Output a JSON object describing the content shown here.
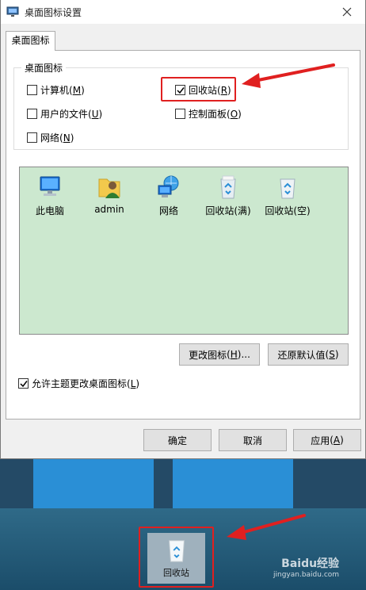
{
  "window": {
    "title": "桌面图标设置"
  },
  "tabs": [
    {
      "label": "桌面图标"
    }
  ],
  "group": {
    "label": "桌面图标",
    "checkboxes": [
      {
        "label": "计算机",
        "key": "M",
        "checked": false
      },
      {
        "label": "回收站",
        "key": "R",
        "checked": true
      },
      {
        "label": "用户的文件",
        "key": "U",
        "checked": false
      },
      {
        "label": "控制面板",
        "key": "O",
        "checked": false
      },
      {
        "label": "网络",
        "key": "N",
        "checked": false
      }
    ]
  },
  "icon_view": {
    "background": "#cce8cf",
    "items": [
      {
        "label": "此电脑",
        "icon": "computer-icon"
      },
      {
        "label": "admin",
        "icon": "user-folder-icon"
      },
      {
        "label": "网络",
        "icon": "network-icon"
      },
      {
        "label": "回收站(满)",
        "icon": "recycle-bin-full-icon"
      },
      {
        "label": "回收站(空)",
        "icon": "recycle-bin-empty-icon"
      }
    ]
  },
  "buttons": {
    "change_icon": {
      "label": "更改图标",
      "key": "H",
      "suffix": "..."
    },
    "restore_default": {
      "label": "还原默认值",
      "key": "S"
    },
    "ok": {
      "label": "确定"
    },
    "cancel": {
      "label": "取消"
    },
    "apply": {
      "label": "应用",
      "key": "A"
    }
  },
  "allow_themes": {
    "label": "允许主题更改桌面图标",
    "key": "L",
    "checked": true
  },
  "desktop": {
    "recycle_bin_label": "回收站"
  },
  "watermark": {
    "main": "Baidu经验",
    "sub": "jingyan.baidu.com"
  },
  "colors": {
    "highlight": "#e02020",
    "selection": "#cce8cf",
    "desktop": "#1f5b7a"
  }
}
